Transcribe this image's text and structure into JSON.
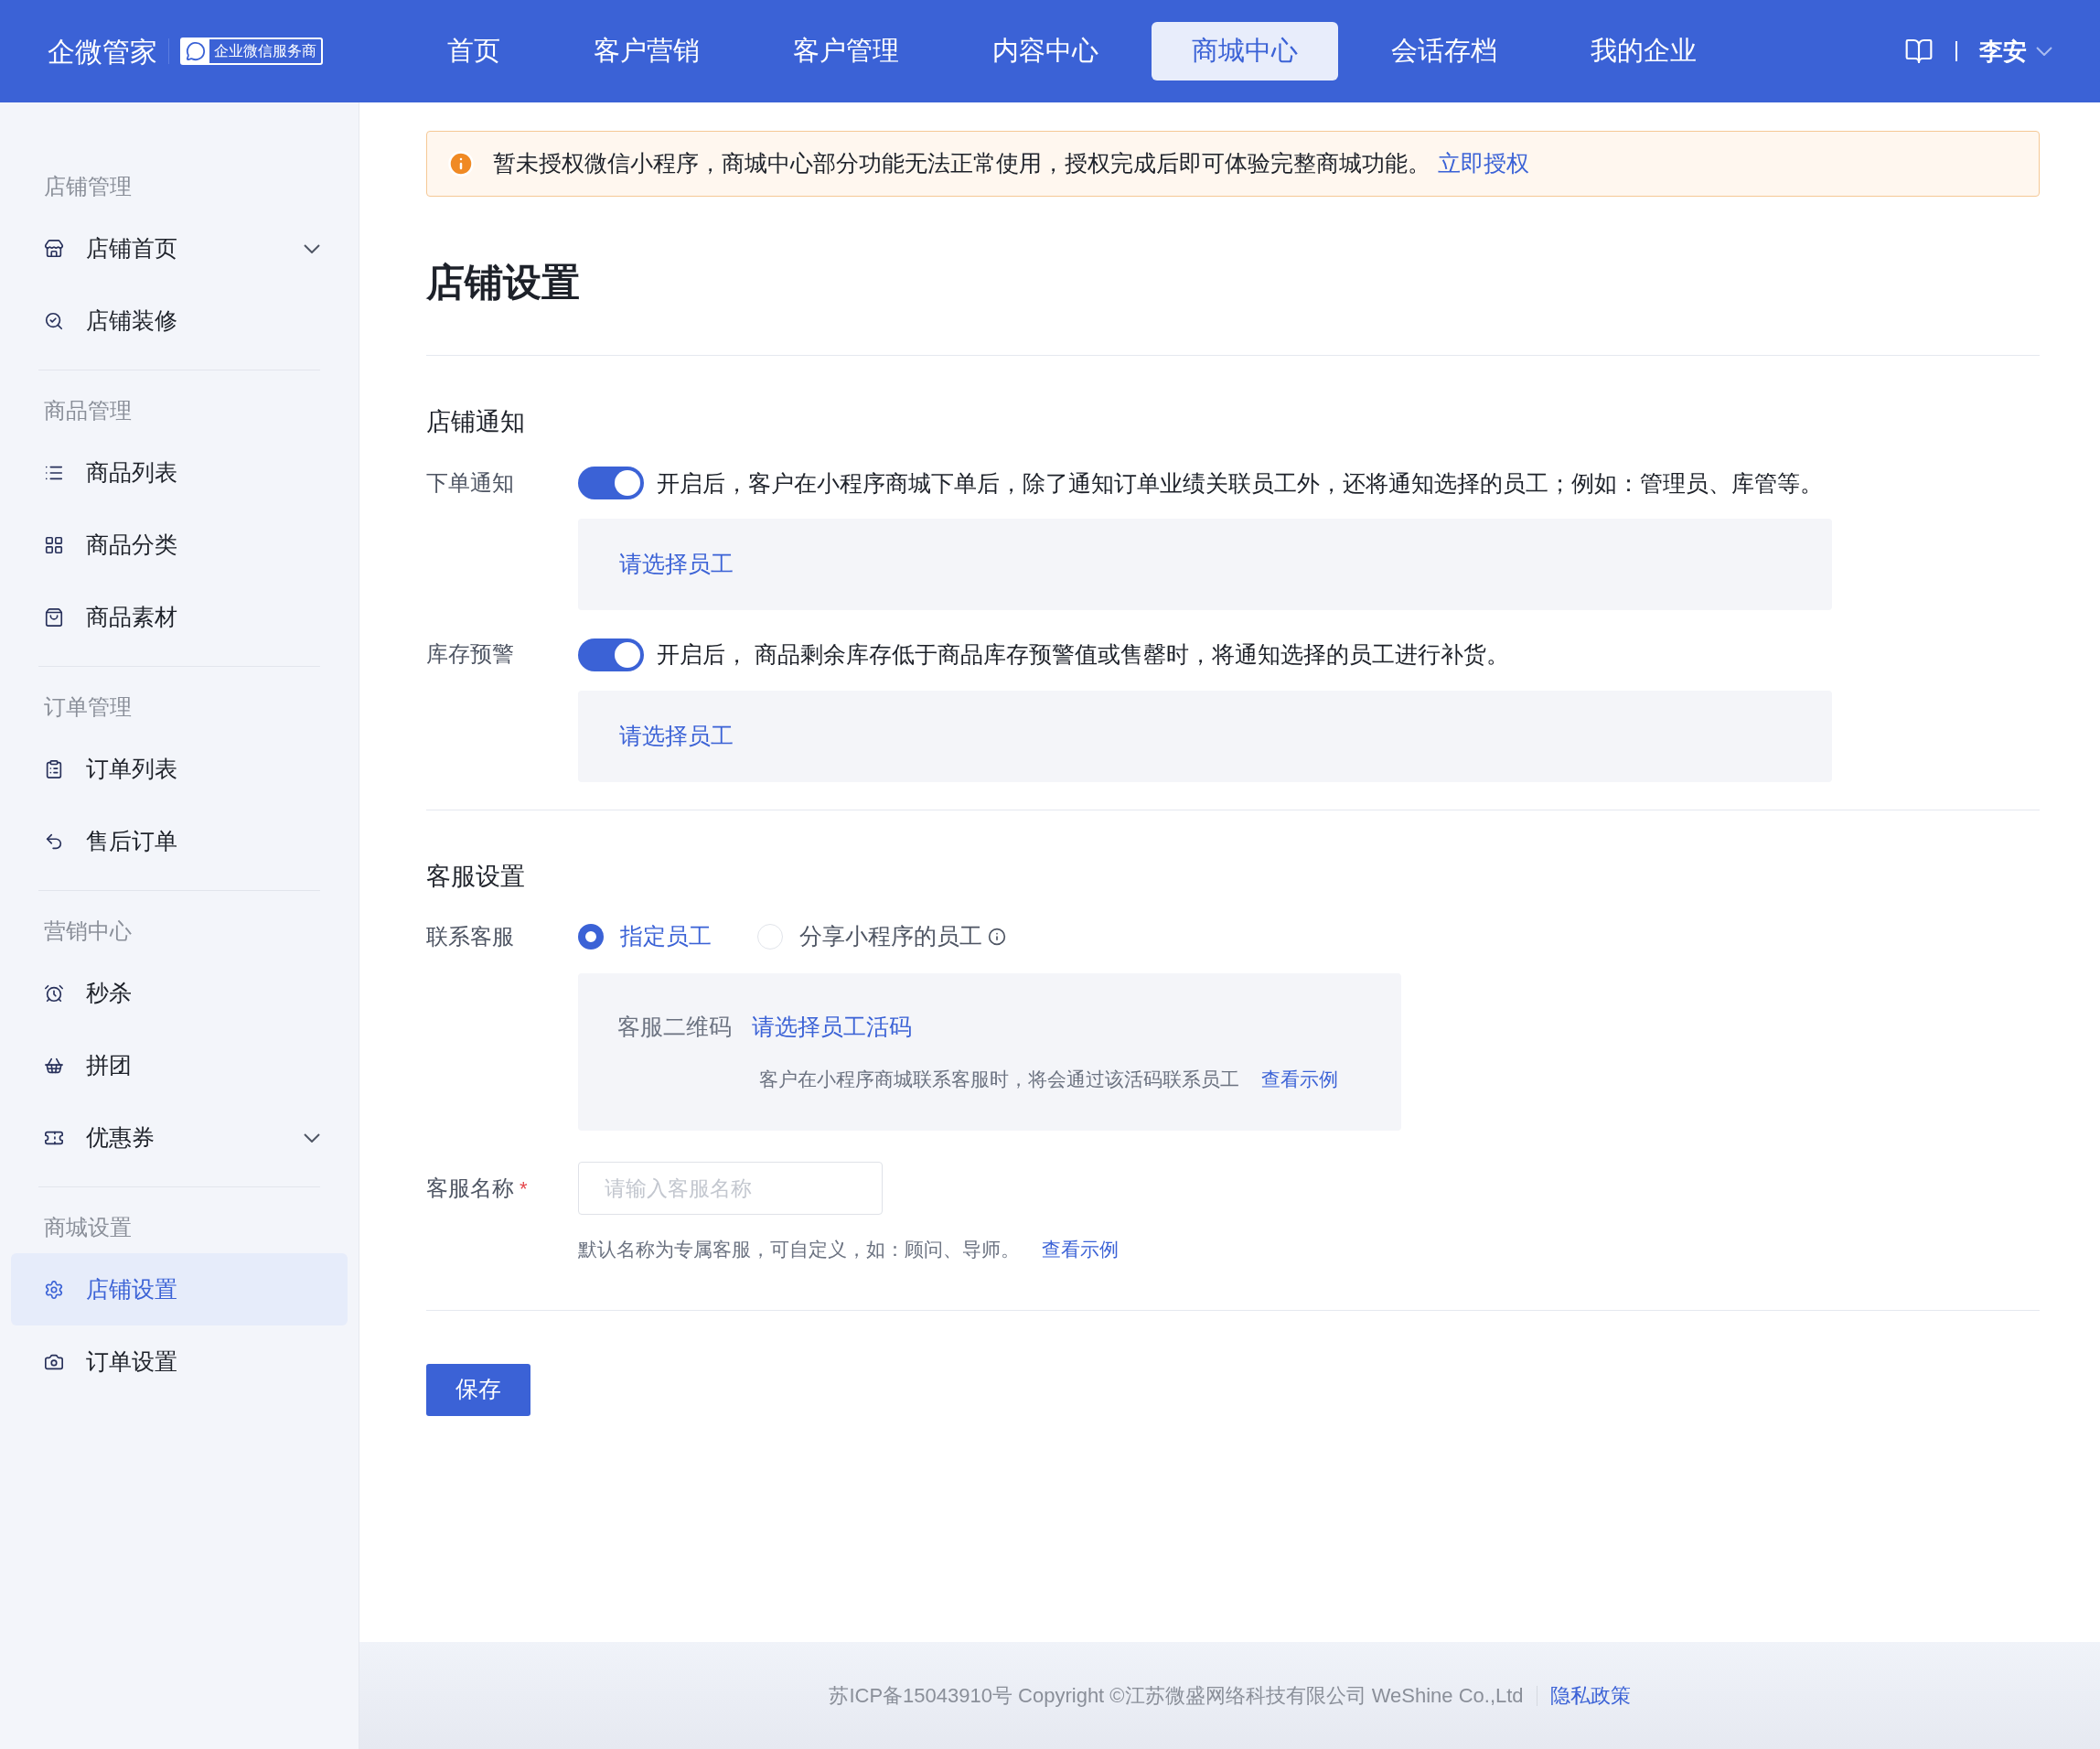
{
  "header": {
    "logo": "企微管家",
    "badge": "企业微信服务商",
    "nav": [
      {
        "label": "首页",
        "selected": false
      },
      {
        "label": "客户营销",
        "selected": false
      },
      {
        "label": "客户管理",
        "selected": false
      },
      {
        "label": "内容中心",
        "selected": false
      },
      {
        "label": "商城中心",
        "selected": true
      },
      {
        "label": "会话存档",
        "selected": false
      },
      {
        "label": "我的企业",
        "selected": false
      }
    ],
    "user": "李安"
  },
  "sidebar": {
    "sections": [
      {
        "title": "店铺管理",
        "items": [
          {
            "label": "店铺首页",
            "selected": false,
            "submenu": true
          },
          {
            "label": "店铺装修",
            "selected": false,
            "submenu": false
          }
        ]
      },
      {
        "title": "商品管理",
        "items": [
          {
            "label": "商品列表",
            "selected": false,
            "submenu": false
          },
          {
            "label": "商品分类",
            "selected": false,
            "submenu": false
          },
          {
            "label": "商品素材",
            "selected": false,
            "submenu": false
          }
        ]
      },
      {
        "title": "订单管理",
        "items": [
          {
            "label": "订单列表",
            "selected": false,
            "submenu": false
          },
          {
            "label": "售后订单",
            "selected": false,
            "submenu": false
          }
        ]
      },
      {
        "title": "营销中心",
        "items": [
          {
            "label": "秒杀",
            "selected": false,
            "submenu": false
          },
          {
            "label": "拼团",
            "selected": false,
            "submenu": false
          },
          {
            "label": "优惠券",
            "selected": false,
            "submenu": true
          }
        ]
      },
      {
        "title": "商城设置",
        "items": [
          {
            "label": "店铺设置",
            "selected": true,
            "submenu": false
          },
          {
            "label": "订单设置",
            "selected": false,
            "submenu": false
          }
        ]
      }
    ]
  },
  "notice": {
    "text": "暂未授权微信小程序，商城中心部分功能无法正常使用，授权完成后即可体验完整商城功能。",
    "link": "立即授权"
  },
  "page_title": "店铺设置",
  "notify": {
    "title": "店铺通知",
    "rows": [
      {
        "label": "下单通知",
        "on": true,
        "description": "开启后，客户在小程序商城下单后，除了通知订单业绩关联员工外，还将通知选择的员工；例如：管理员、库管等。",
        "picker": "请选择员工"
      },
      {
        "label": "库存预警",
        "on": true,
        "description": "开启后， 商品剩余库存低于商品库存预警值或售罄时，将通知选择的员工进行补货。",
        "picker": "请选择员工"
      }
    ]
  },
  "service": {
    "title": "客服设置",
    "contact_label": "联系客服",
    "options": [
      {
        "label": "指定员工",
        "selected": true,
        "info": false
      },
      {
        "label": "分享小程序的员工",
        "selected": false,
        "info": true
      }
    ],
    "qr": {
      "label": "客服二维码",
      "link": "请选择员工活码",
      "hint": "客户在小程序商城联系客服时，将会通过该活码联系员工",
      "hint_link": "查看示例"
    },
    "name": {
      "label": "客服名称",
      "required_mark": "*",
      "placeholder": "请输入客服名称",
      "hint": "默认名称为专属客服，可自定义，如：顾问、导师。",
      "hint_link": "查看示例"
    }
  },
  "save": "保存",
  "footer": {
    "text": "苏ICP备15043910号 Copyright ©江苏微盛网络科技有限公司 WeShine Co.,Ltd",
    "link": "隐私政策"
  }
}
